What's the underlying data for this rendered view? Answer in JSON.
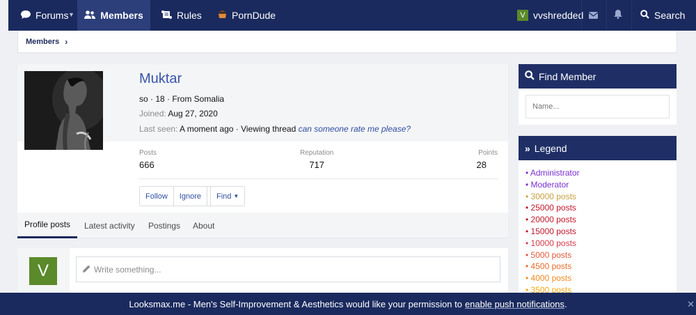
{
  "nav": {
    "forums": "Forums",
    "members": "Members",
    "rules": "Rules",
    "porndude": "PornDude",
    "username": "vvshredded",
    "user_initial": "V",
    "search": "Search"
  },
  "breadcrumb": {
    "members": "Members"
  },
  "profile": {
    "name": "Muktar",
    "blurb": "so · 18 · From Somalia",
    "joined_label": "Joined:",
    "joined_value": "Aug 27, 2020",
    "last_seen_label": "Last seen:",
    "last_seen_value": "A moment ago · Viewing thread",
    "last_seen_thread": "can someone rate me please?",
    "stats": [
      {
        "label": "Posts",
        "value": "666"
      },
      {
        "label": "Reputation",
        "value": "717"
      },
      {
        "label": "Points",
        "value": "28"
      }
    ],
    "buttons": {
      "follow": "Follow",
      "ignore": "Ignore",
      "find": "Find"
    },
    "tabs": [
      "Profile posts",
      "Latest activity",
      "Postings",
      "About"
    ]
  },
  "write": {
    "avatar_initial": "V",
    "placeholder": "Write something..."
  },
  "sidebar": {
    "find_member": {
      "title": "Find Member",
      "placeholder": "Name..."
    },
    "legend": {
      "title": "Legend",
      "items": [
        {
          "label": "Administrator",
          "color": "#7a2fd0"
        },
        {
          "label": "Moderator",
          "color": "#7a2fd0"
        },
        {
          "label": "30000 posts",
          "color": "#c9a040"
        },
        {
          "label": "25000 posts",
          "color": "#c0182a"
        },
        {
          "label": "20000 posts",
          "color": "#c0182a"
        },
        {
          "label": "15000 posts",
          "color": "#c0182a"
        },
        {
          "label": "10000 posts",
          "color": "#d23a4a"
        },
        {
          "label": "5000 posts",
          "color": "#e05a3a"
        },
        {
          "label": "4500 posts",
          "color": "#e86a2a"
        },
        {
          "label": "4000 posts",
          "color": "#f08a20"
        },
        {
          "label": "3500 posts",
          "color": "#f5a815"
        }
      ]
    }
  },
  "banner": {
    "text": "Looksmax.me - Men's Self-Improvement & Aesthetics would like your permission to",
    "link": "enable push notifications",
    "end": "."
  },
  "colors": {
    "nav_bg": "#1a2a5e",
    "accent": "#3a55a8",
    "avatar_green": "#5a8a2a"
  }
}
